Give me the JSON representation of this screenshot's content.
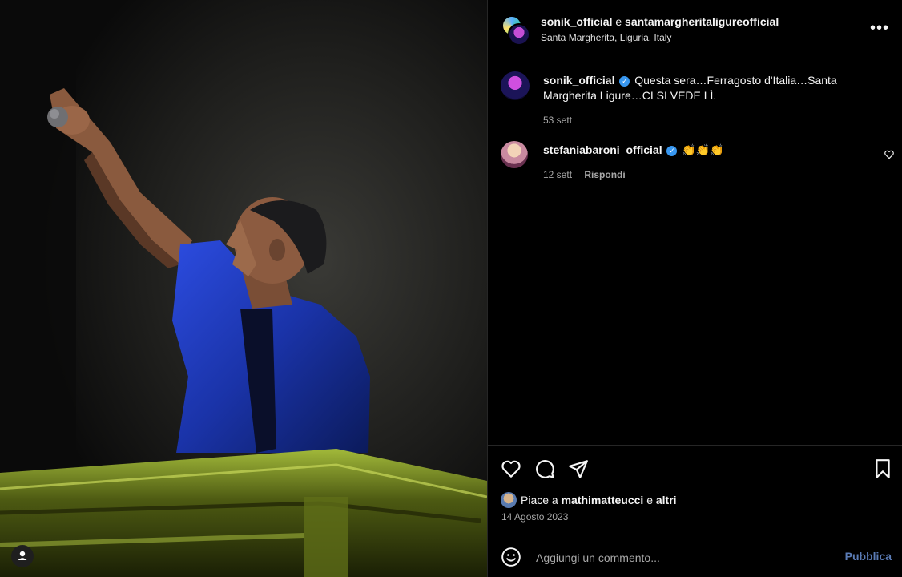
{
  "post": {
    "author": "sonik_official",
    "conjunction": "e",
    "collaborator": "santamargheritaligureofficial",
    "location": "Santa Margherita, Liguria, Italy",
    "more_label": "•••"
  },
  "caption": {
    "username": "sonik_official",
    "text": "Questa sera…Ferragosto d'Italia…Santa Margherita Ligure…CI SI VEDE LÌ.",
    "age": "53 sett"
  },
  "comments": [
    {
      "username": "stefaniabaroni_official",
      "text": "👏👏👏",
      "age": "12 sett",
      "reply_label": "Rispondi"
    }
  ],
  "likes": {
    "prefix": "Piace a",
    "user": "mathimatteucci",
    "conj": "e",
    "others": "altri"
  },
  "date": "14 Agosto 2023",
  "composer": {
    "placeholder": "Aggiungi un commento...",
    "publish_label": "Pubblica"
  },
  "colors": {
    "verified": "#3897f0",
    "publish": "#5a7bb5",
    "shirt": "#1f3fbf",
    "stage_light": "#8aa51f"
  }
}
